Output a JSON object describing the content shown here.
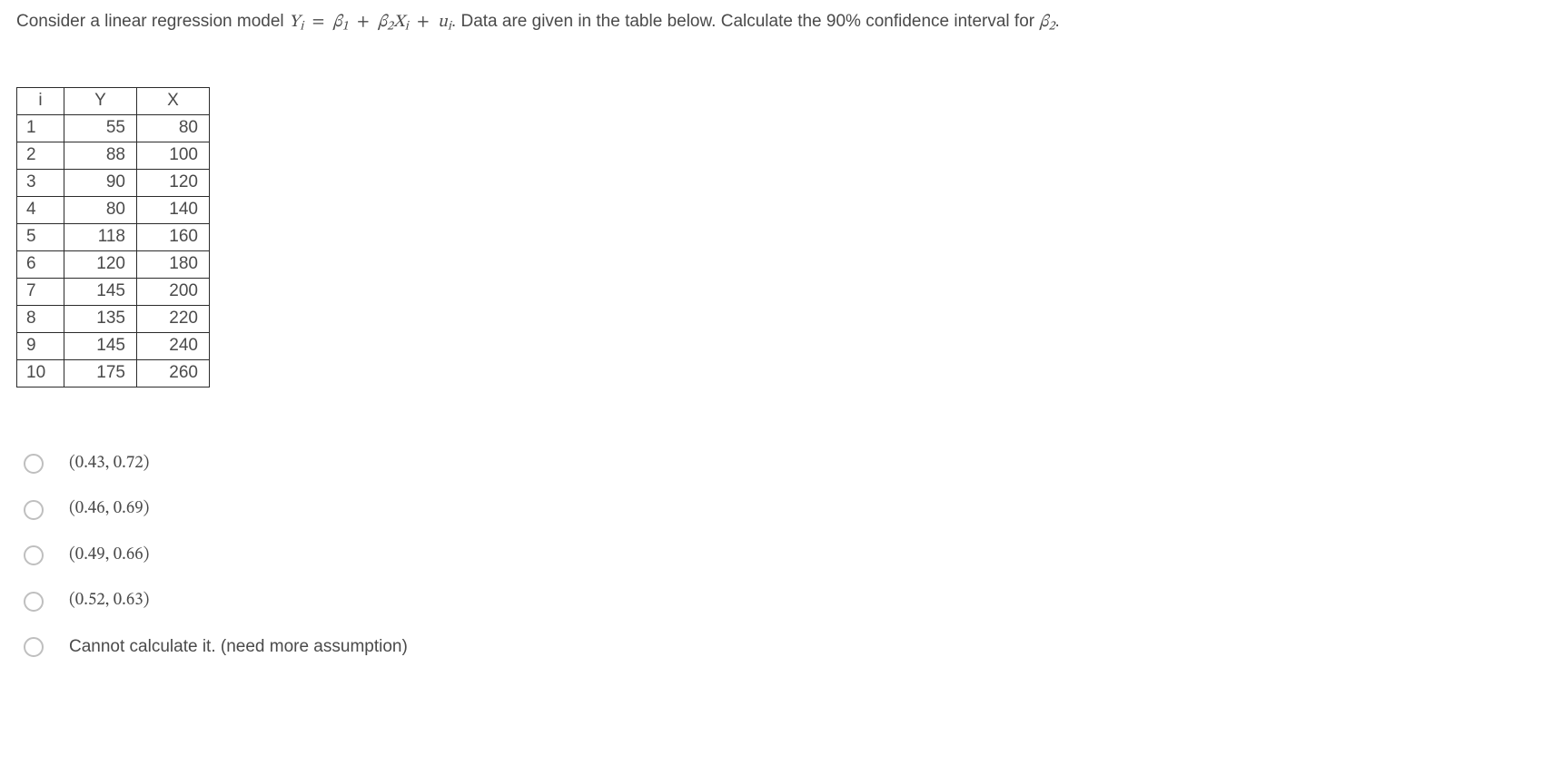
{
  "question": {
    "prefix": "Consider a linear regression model ",
    "model_lhs_var": "Y",
    "model_lhs_sub": "i",
    "eq_sign": "=",
    "beta1_var": "β",
    "beta1_sub": "1",
    "plus1": "+",
    "beta2_var": "β",
    "beta2_sub": "2",
    "x_var": "X",
    "x_sub": "i",
    "plus2": "+",
    "u_var": "u",
    "u_sub": "i",
    "after_model": ". Data are given in the table below. Calculate the 90% confidence interval for ",
    "target_var": "β",
    "target_sub": "2",
    "period": "."
  },
  "table": {
    "headers": {
      "i": "i",
      "Y": "Y",
      "X": "X"
    },
    "rows": [
      {
        "i": "1",
        "Y": "55",
        "X": "80"
      },
      {
        "i": "2",
        "Y": "88",
        "X": "100"
      },
      {
        "i": "3",
        "Y": "90",
        "X": "120"
      },
      {
        "i": "4",
        "Y": "80",
        "X": "140"
      },
      {
        "i": "5",
        "Y": "118",
        "X": "160"
      },
      {
        "i": "6",
        "Y": "120",
        "X": "180"
      },
      {
        "i": "7",
        "Y": "145",
        "X": "200"
      },
      {
        "i": "8",
        "Y": "135",
        "X": "220"
      },
      {
        "i": "9",
        "Y": "145",
        "X": "240"
      },
      {
        "i": "10",
        "Y": "175",
        "X": "260"
      }
    ]
  },
  "options": [
    {
      "label": "(0.43, 0.72)",
      "math": true
    },
    {
      "label": "(0.46, 0.69)",
      "math": true
    },
    {
      "label": "(0.49, 0.66)",
      "math": true
    },
    {
      "label": "(0.52, 0.63)",
      "math": true
    },
    {
      "label": "Cannot calculate it. (need more assumption)",
      "math": false
    }
  ]
}
